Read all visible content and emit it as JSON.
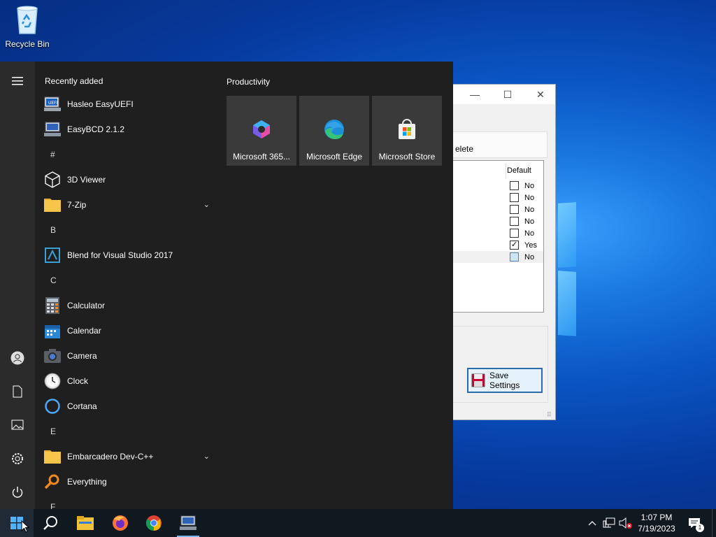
{
  "desktop": {
    "recycle_bin_label": "Recycle Bin"
  },
  "app_window": {
    "minimize_glyph": "—",
    "maximize_glyph": "☐",
    "close_glyph": "✕",
    "toolbar_partial_text": "elete",
    "column_header": "Default",
    "rows": [
      {
        "checked": false,
        "label": "No"
      },
      {
        "checked": false,
        "label": "No"
      },
      {
        "checked": false,
        "label": "No"
      },
      {
        "checked": false,
        "label": "No"
      },
      {
        "checked": false,
        "label": "No"
      },
      {
        "checked": true,
        "label": "Yes"
      },
      {
        "checked": false,
        "label": "No"
      }
    ],
    "save_button_label": "Save Settings"
  },
  "start_menu": {
    "recently_added_title": "Recently added",
    "recently_added": [
      {
        "label": "Hasleo EasyUEFI",
        "icon": "easyuefi-icon"
      },
      {
        "label": "EasyBCD 2.1.2",
        "icon": "easybcd-icon"
      }
    ],
    "groups": [
      {
        "letter": "#",
        "items": [
          {
            "label": "3D Viewer",
            "icon": "3d-viewer-icon",
            "expandable": false
          },
          {
            "label": "7-Zip",
            "icon": "folder-icon",
            "expandable": true
          }
        ]
      },
      {
        "letter": "B",
        "items": [
          {
            "label": "Blend for Visual Studio 2017",
            "icon": "blend-icon",
            "expandable": false
          }
        ]
      },
      {
        "letter": "C",
        "items": [
          {
            "label": "Calculator",
            "icon": "calculator-icon",
            "expandable": false
          },
          {
            "label": "Calendar",
            "icon": "calendar-icon",
            "expandable": false
          },
          {
            "label": "Camera",
            "icon": "camera-icon",
            "expandable": false
          },
          {
            "label": "Clock",
            "icon": "clock-icon",
            "expandable": false
          },
          {
            "label": "Cortana",
            "icon": "cortana-icon",
            "expandable": false
          }
        ]
      },
      {
        "letter": "E",
        "items": [
          {
            "label": "Embarcadero Dev-C++",
            "icon": "folder-icon",
            "expandable": true
          },
          {
            "label": "Everything",
            "icon": "everything-icon",
            "expandable": false
          }
        ]
      },
      {
        "letter": "F",
        "items": []
      }
    ],
    "chevron_glyph": "⌄",
    "tiles_title": "Productivity",
    "tiles": [
      {
        "label": "Microsoft 365...",
        "icon": "microsoft-365-icon"
      },
      {
        "label": "Microsoft Edge",
        "icon": "edge-icon"
      },
      {
        "label": "Microsoft Store",
        "icon": "store-icon"
      }
    ]
  },
  "taskbar": {
    "time": "1:07 PM",
    "date": "7/19/2023",
    "notification_count": "1"
  }
}
